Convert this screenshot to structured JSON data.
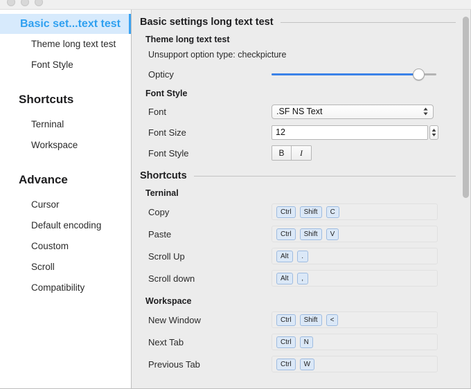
{
  "window": {
    "controls": [
      "close-button",
      "minimize-button",
      "zoom-button"
    ]
  },
  "sidebar": {
    "groups": [
      {
        "title": "",
        "items": [
          {
            "label": "Basic set...text test",
            "selected": true
          },
          {
            "label": "Theme long text test",
            "selected": false
          },
          {
            "label": "Font Style",
            "selected": false
          }
        ]
      },
      {
        "title": "Shortcuts",
        "items": [
          {
            "label": "Terninal",
            "selected": false
          },
          {
            "label": "Workspace",
            "selected": false
          }
        ]
      },
      {
        "title": "Advance",
        "items": [
          {
            "label": "Cursor",
            "selected": false
          },
          {
            "label": "Default encoding",
            "selected": false
          },
          {
            "label": "Coustom",
            "selected": false
          },
          {
            "label": "Scroll",
            "selected": false
          },
          {
            "label": "Compatibility",
            "selected": false
          }
        ]
      }
    ]
  },
  "main": {
    "basic_section": {
      "title": "Basic settings long text test",
      "theme_sub_head": "Theme long text test",
      "unsupported_note": "Unsupport option type: checkpicture",
      "opacity_label": "Opticy",
      "opacity_percent": 89
    },
    "font_section": {
      "sub_head": "Font Style",
      "font_label": "Font",
      "font_value": ".SF NS Text",
      "font_size_label": "Font Size",
      "font_size_value": "12",
      "font_style_label": "Font Style",
      "bold_label": "B",
      "italic_label": "I"
    },
    "shortcuts_section": {
      "title": "Shortcuts",
      "terminal_sub_head": "Terninal",
      "terminal_rows": [
        {
          "label": "Copy",
          "keys": [
            "Ctrl",
            "Shift",
            "C"
          ]
        },
        {
          "label": "Paste",
          "keys": [
            "Ctrl",
            "Shift",
            "V"
          ]
        },
        {
          "label": "Scroll Up",
          "keys": [
            "Alt",
            "."
          ]
        },
        {
          "label": "Scroll down",
          "keys": [
            "Alt",
            ","
          ]
        }
      ],
      "workspace_sub_head": "Workspace",
      "workspace_rows": [
        {
          "label": "New Window",
          "keys": [
            "Ctrl",
            "Shift",
            "<"
          ]
        },
        {
          "label": "Next Tab",
          "keys": [
            "Ctrl",
            "N"
          ]
        },
        {
          "label": "Previous Tab",
          "keys": [
            "Ctrl",
            "W"
          ]
        }
      ]
    }
  },
  "colors": {
    "accent_blue": "#3b82e8",
    "selected_bg": "#d7eafc",
    "selected_text": "#2fa0f0",
    "key_bg": "#dbe8f7",
    "key_border": "#9dbbe0",
    "window_bg": "#ececec"
  }
}
